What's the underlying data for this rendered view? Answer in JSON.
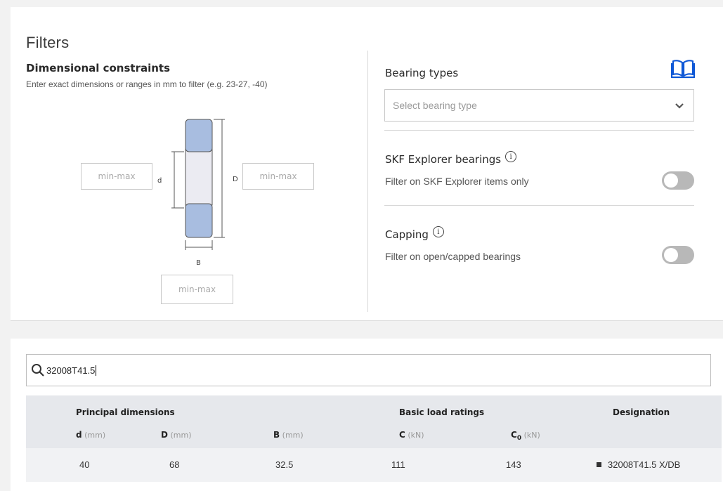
{
  "filters": {
    "title": "Filters",
    "dimensional": {
      "title": "Dimensional constraints",
      "hint": "Enter exact dimensions or ranges in mm to filter (e.g. 23-27, -40)",
      "d_label": "d",
      "D_label": "D",
      "B_label": "B",
      "d_placeholder": "min-max",
      "D_placeholder": "min-max",
      "B_placeholder": "min-max"
    },
    "bearing_types": {
      "title": "Bearing types",
      "placeholder": "Select bearing type",
      "book_icon": "book-icon"
    },
    "explorer": {
      "title": "SKF Explorer bearings",
      "description": "Filter on SKF Explorer items only",
      "enabled": false
    },
    "capping": {
      "title": "Capping",
      "description": "Filter on open/capped bearings",
      "enabled": false
    },
    "colors": {
      "ring": "#a8bde0",
      "toggle_off": "#b8b8b8"
    }
  },
  "results": {
    "search_value": "32008T41.5",
    "headers": {
      "principal": "Principal dimensions",
      "load": "Basic load ratings",
      "designation": "Designation"
    },
    "columns": {
      "d": "d",
      "D": "D",
      "B": "B",
      "C": "C",
      "C0": "C",
      "C0_sub": "0",
      "mm": "(mm)",
      "kN": "(kN)"
    },
    "rows": [
      {
        "d": "40",
        "D": "68",
        "B": "32.5",
        "C": "111",
        "C0": "143",
        "designation": "32008T41.5 X/DB"
      }
    ]
  }
}
